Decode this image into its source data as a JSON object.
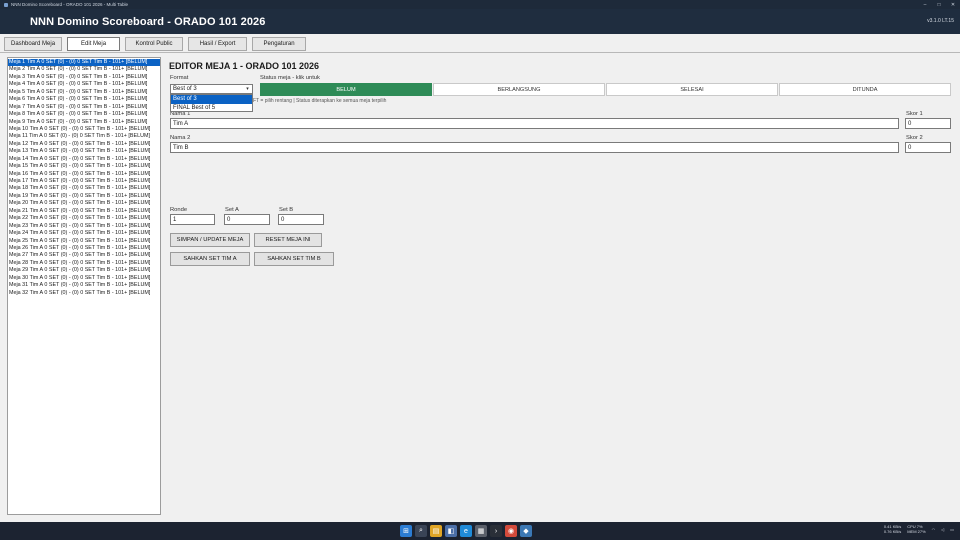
{
  "window": {
    "title": "NNN Domino Scoreboard - ORADO 101 2026 - Multi Table",
    "controls": [
      "–",
      "□",
      "✕"
    ]
  },
  "header": {
    "title": "NNN Domino Scoreboard - ORADO 101 2026",
    "version": "v3.1.0 LT.15"
  },
  "tabs": [
    {
      "label": "Dashboard Meja",
      "active": false
    },
    {
      "label": "Edit Meja",
      "active": true
    },
    {
      "label": "Kontrol Public",
      "active": false
    },
    {
      "label": "Hasil / Export",
      "active": false
    },
    {
      "label": "Pengaturan",
      "active": false
    }
  ],
  "meja_list": [
    "Meja 1   Tim A  0 SET  (0)  -  (0)  0 SET  Tim B  -  101+  [BELUM]",
    "Meja 2   Tim A  0 SET  (0)  -  (0)  0 SET  Tim B  -  101+  [BELUM]",
    "Meja 3   Tim A  0 SET  (0)  -  (0)  0 SET  Tim B  -  101+  [BELUM]",
    "Meja 4   Tim A  0 SET  (0)  -  (0)  0 SET  Tim B  -  101+  [BELUM]",
    "Meja 5   Tim A  0 SET  (0)  -  (0)  0 SET  Tim B  -  101+  [BELUM]",
    "Meja 6   Tim A  0 SET  (0)  -  (0)  0 SET  Tim B  -  101+  [BELUM]",
    "Meja 7   Tim A  0 SET  (0)  -  (0)  0 SET  Tim B  -  101+  [BELUM]",
    "Meja 8   Tim A  0 SET  (0)  -  (0)  0 SET  Tim B  -  101+  [BELUM]",
    "Meja 9   Tim A  0 SET  (0)  -  (0)  0 SET  Tim B  -  101+  [BELUM]",
    "Meja 10   Tim A  0 SET  (0)  -  (0)  0 SET  Tim B  -  101+  [BELUM]",
    "Meja 11   Tim A  0 SET  (0)  -  (0)  0 SET  Tim B  -  101+  [BELUM]",
    "Meja 12   Tim A  0 SET  (0)  -  (0)  0 SET  Tim B  -  101+  [BELUM]",
    "Meja 13   Tim A  0 SET  (0)  -  (0)  0 SET  Tim B  -  101+  [BELUM]",
    "Meja 14   Tim A  0 SET  (0)  -  (0)  0 SET  Tim B  -  101+  [BELUM]",
    "Meja 15   Tim A  0 SET  (0)  -  (0)  0 SET  Tim B  -  101+  [BELUM]",
    "Meja 16   Tim A  0 SET  (0)  -  (0)  0 SET  Tim B  -  101+  [BELUM]",
    "Meja 17   Tim A  0 SET  (0)  -  (0)  0 SET  Tim B  -  101+  [BELUM]",
    "Meja 18   Tim A  0 SET  (0)  -  (0)  0 SET  Tim B  -  101+  [BELUM]",
    "Meja 19   Tim A  0 SET  (0)  -  (0)  0 SET  Tim B  -  101+  [BELUM]",
    "Meja 20   Tim A  0 SET  (0)  -  (0)  0 SET  Tim B  -  101+  [BELUM]",
    "Meja 21   Tim A  0 SET  (0)  -  (0)  0 SET  Tim B  -  101+  [BELUM]",
    "Meja 22   Tim A  0 SET  (0)  -  (0)  0 SET  Tim B  -  101+  [BELUM]",
    "Meja 23   Tim A  0 SET  (0)  -  (0)  0 SET  Tim B  -  101+  [BELUM]",
    "Meja 24   Tim A  0 SET  (0)  -  (0)  0 SET  Tim B  -  101+  [BELUM]",
    "Meja 25   Tim A  0 SET  (0)  -  (0)  0 SET  Tim B  -  101+  [BELUM]",
    "Meja 26   Tim A  0 SET  (0)  -  (0)  0 SET  Tim B  -  101+  [BELUM]",
    "Meja 27   Tim A  0 SET  (0)  -  (0)  0 SET  Tim B  -  101+  [BELUM]",
    "Meja 28   Tim A  0 SET  (0)  -  (0)  0 SET  Tim B  -  101+  [BELUM]",
    "Meja 29   Tim A  0 SET  (0)  -  (0)  0 SET  Tim B  -  101+  [BELUM]",
    "Meja 30   Tim A  0 SET  (0)  -  (0)  0 SET  Tim B  -  101+  [BELUM]",
    "Meja 31   Tim A  0 SET  (0)  -  (0)  0 SET  Tim B  -  101+  [BELUM]",
    "Meja 32   Tim A  0 SET  (0)  -  (0)  0 SET  Tim B  -  101+  [BELUM]"
  ],
  "selected_meja_index": 0,
  "editor": {
    "title": "EDITOR MEJA 1 - ORADO 101 2026",
    "format_label": "Format",
    "format_value": "Best of 3",
    "format_options": [
      "Best of 3",
      "FINAL Best of 5"
    ],
    "status_label": "Status meja - klik untuk",
    "status_buttons": [
      {
        "label": "BELUM",
        "active": true
      },
      {
        "label": "BERLANGSUNG",
        "active": false
      },
      {
        "label": "SELESAI",
        "active": false
      },
      {
        "label": "DITUNDA",
        "active": false
      }
    ],
    "hint": "FT = pilih rentang | Status diterapkan ke semua meja terpilih",
    "nama1_label": "Nama 1",
    "nama1_value": "Tim A",
    "skor1_label": "Skor 1",
    "skor1_value": "0",
    "nama2_label": "Nama 2",
    "nama2_value": "Tim B",
    "skor2_label": "Skor 2",
    "skor2_value": "0",
    "ronde_label": "Ronde",
    "ronde_value": "1",
    "seta_label": "Set A",
    "seta_value": "0",
    "setb_label": "Set B",
    "setb_value": "0",
    "btn_simpan": "SIMPAN / UPDATE MEJA",
    "btn_reset": "RESET MEJA INI",
    "btn_sah_a": "SAHKAN SET TIM A",
    "btn_sah_b": "SAHKAN SET TIM B"
  },
  "colors": {
    "accent": "#0b62c4",
    "status_active": "#2e8b57",
    "header_bg": "#1f2d3f"
  },
  "taskbar": {
    "icons": [
      "windows-icon",
      "search-icon",
      "explorer-icon",
      "app-icon",
      "edge-icon",
      "store-icon",
      "terminal-icon",
      "chrome-icon",
      "python-icon"
    ],
    "net_up": "0.41 KB/s",
    "net_down": "0.76 KB/s",
    "cpu": "CPU 7%",
    "mem": "MEM 27%"
  }
}
